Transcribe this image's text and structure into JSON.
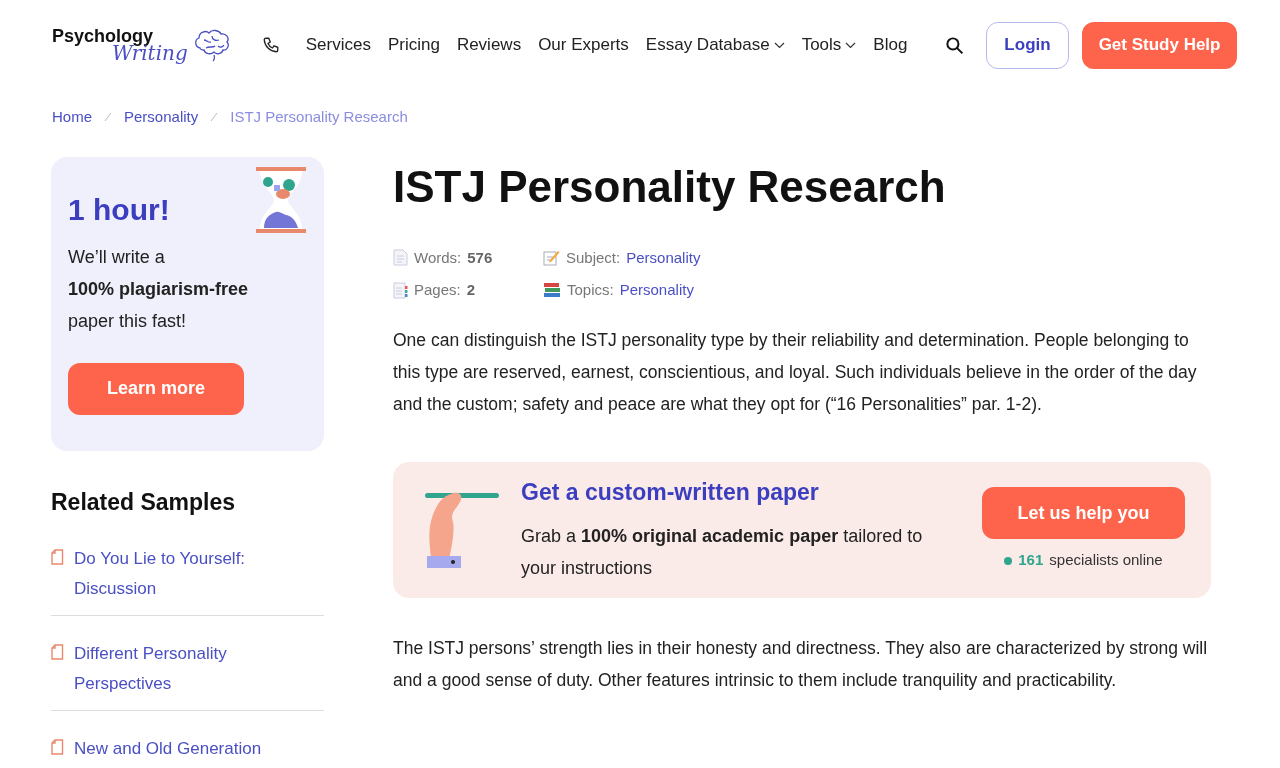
{
  "header": {
    "logo": {
      "line_1": "Psychology",
      "line_2": "Writing"
    },
    "nav": [
      {
        "label": "Services",
        "has_menu": false
      },
      {
        "label": "Pricing",
        "has_menu": false
      },
      {
        "label": "Reviews",
        "has_menu": false
      },
      {
        "label": "Our Experts",
        "has_menu": false
      },
      {
        "label": "Essay Database",
        "has_menu": true
      },
      {
        "label": "Tools",
        "has_menu": true
      },
      {
        "label": "Blog",
        "has_menu": false
      }
    ],
    "login": "Login",
    "cta": "Get Study Help"
  },
  "breadcrumb": [
    {
      "label": "Home",
      "current": false
    },
    {
      "label": "Personality",
      "current": false
    },
    {
      "label": "ISTJ Personality Research",
      "current": true
    }
  ],
  "sidebar": {
    "promo": {
      "title": "1 hour!",
      "text": "We’ll write a **100% plagiarism-free** paper this fast!",
      "button": "Learn more"
    },
    "related": {
      "title": "Related Samples",
      "items": [
        "Do You Lie to Yourself: Discussion",
        "Different Personality Perspectives",
        "New and Old Generation"
      ]
    }
  },
  "article": {
    "title": "ISTJ Personality Research",
    "meta": [
      {
        "kind": "words",
        "label": "Words:",
        "value": "576",
        "link": false
      },
      {
        "kind": "subject",
        "label": "Subject:",
        "value": "Personality",
        "link": true
      },
      {
        "kind": "pages",
        "label": "Pages:",
        "value": "2",
        "link": false
      },
      {
        "kind": "topics",
        "label": "Topics:",
        "value": "Personality",
        "link": true
      }
    ],
    "paragraph_1": "One can distinguish the ISTJ personality type by their reliability and determination. People belonging to this type are reserved, earnest, conscientious, and loyal. Such individuals believe in the order of the day and the custom; safety and peace are what they opt for (“16 Personalities” par. 1-2).",
    "banner": {
      "title": "Get a custom-written paper",
      "text": "Grab a **100% original academic paper** tailored to your instructions",
      "button": "Let us help you",
      "online_count": "161",
      "online_label": "specialists online"
    },
    "paragraph_2": "The ISTJ persons’ strength lies in their honesty and directness. They also are characterized by strong will and a good sense of duty. Other features intrinsic to them include tranquility and practicability."
  }
}
